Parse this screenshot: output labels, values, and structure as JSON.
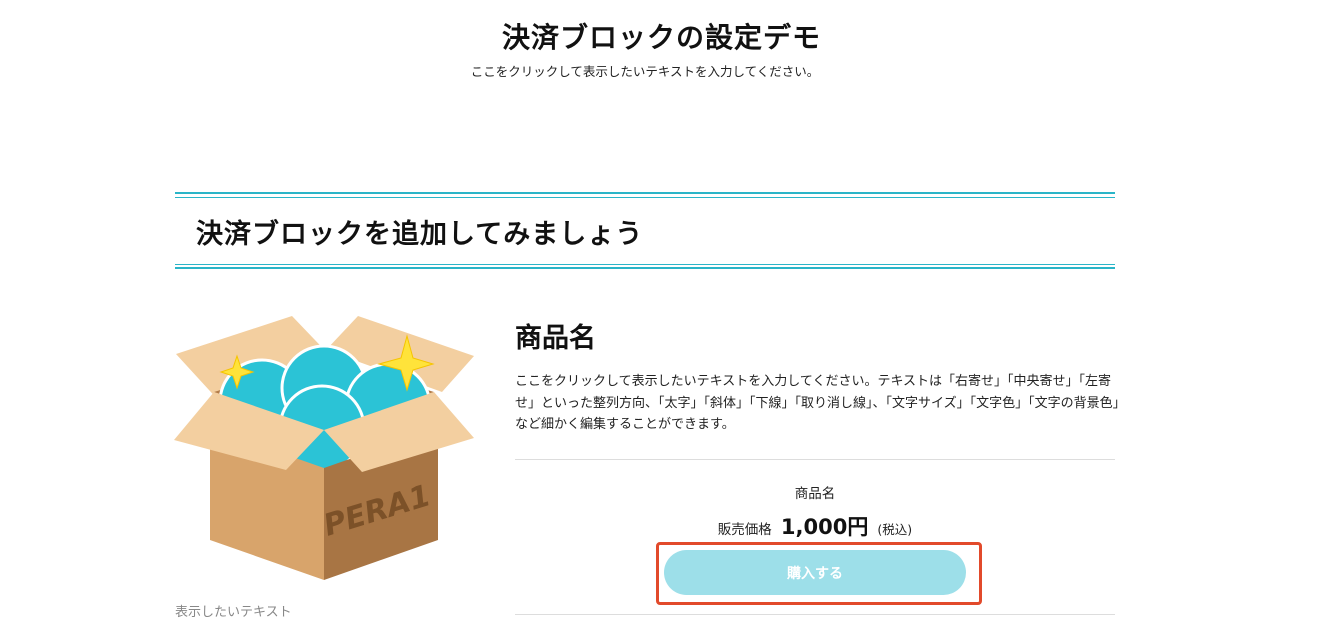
{
  "header": {
    "title": "決済ブロックの設定デモ",
    "subtitle": "ここをクリックして表示したいテキストを入力してください。"
  },
  "section": {
    "heading": "決済ブロックを追加してみましょう",
    "accent_color": "#2ab5c8"
  },
  "product": {
    "image_icon": "open-cardboard-box-with-balls",
    "image_box_text": "PERA1",
    "image_caption": "表示したいテキスト",
    "name": "商品名",
    "description": "ここをクリックして表示したいテキストを入力してください。テキストは「右寄せ」「中央寄せ」「左寄せ」といった整列方向、「太字」「斜体」「下線」「取り消し線」、「文字サイズ」「文字色」「文字の背景色」など細かく編集することができます。"
  },
  "payment": {
    "product_name": "商品名",
    "price_label": "販売価格",
    "price_value": "1,000円",
    "tax_note": "(税込)",
    "buy_button_label": "購入する",
    "buy_button_color": "#9ddfe9",
    "highlight_color": "#e24a2b"
  }
}
